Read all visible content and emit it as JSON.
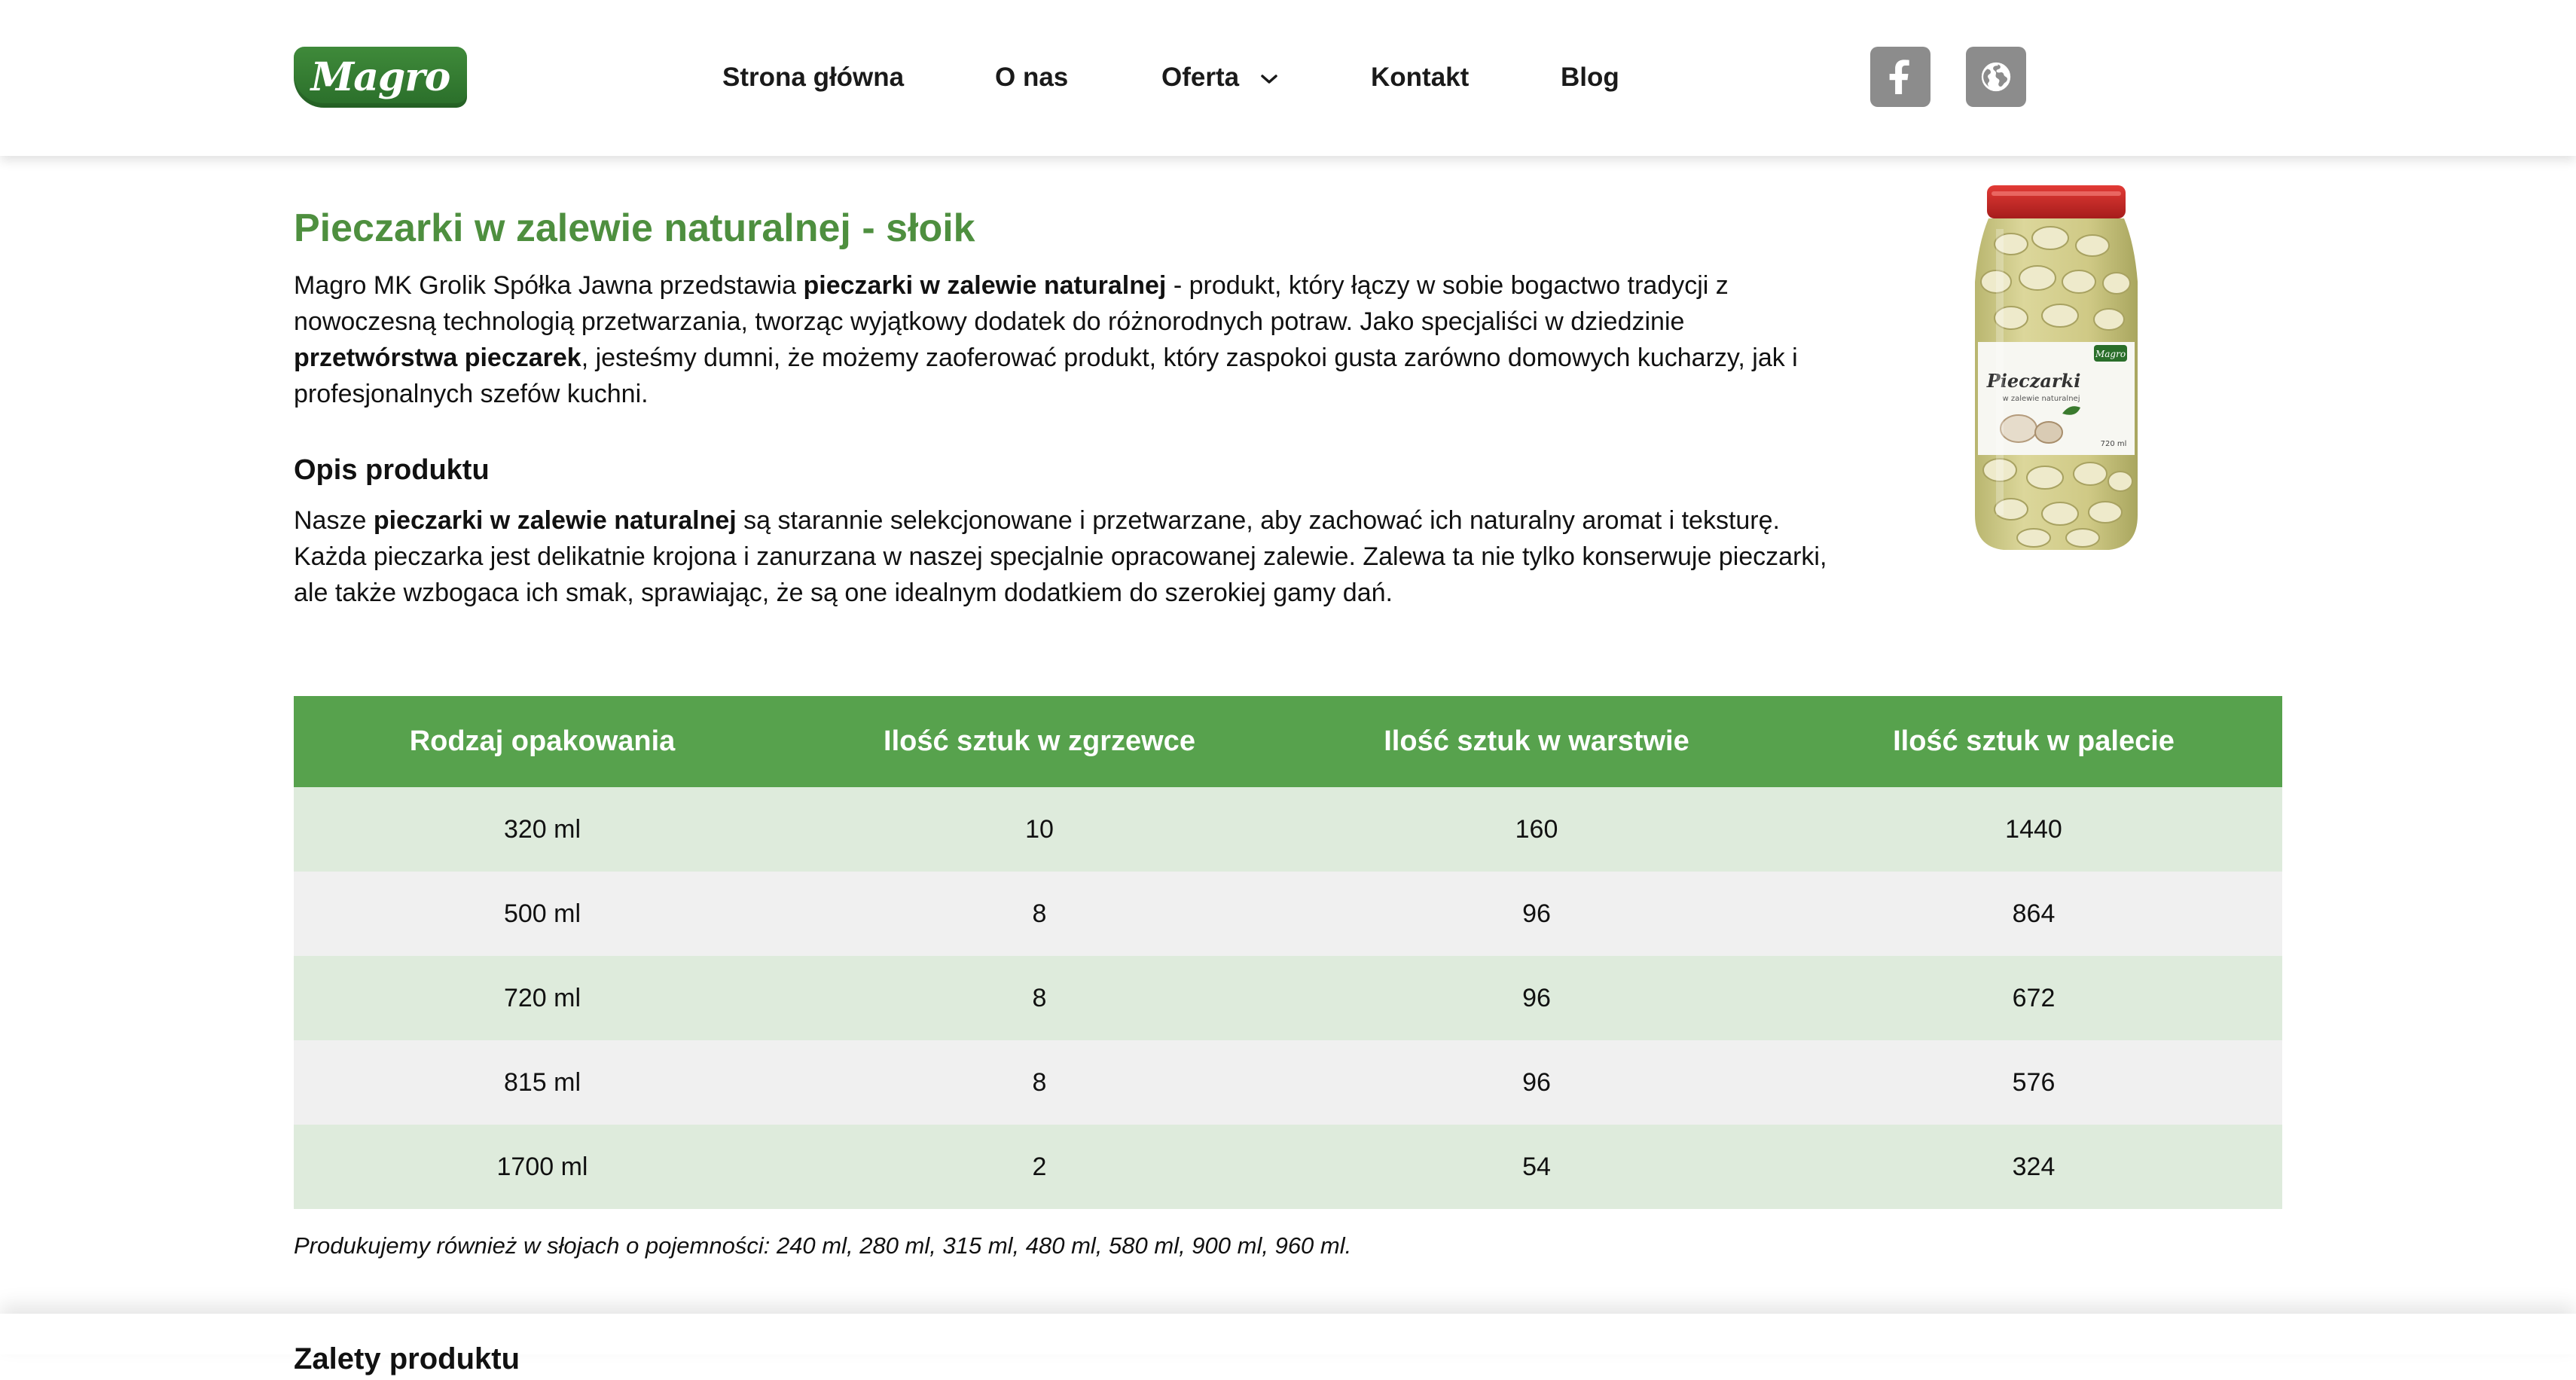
{
  "header": {
    "logo_text": "Magro",
    "nav": [
      "Strona główna",
      "O nas",
      "Oferta",
      "Kontakt",
      "Blog"
    ],
    "social": [
      "facebook-icon",
      "globe-icon"
    ]
  },
  "product": {
    "title": "Pieczarki w zalewie naturalnej - słoik",
    "intro": {
      "p1": "Magro MK Grolik Spółka Jawna przedstawia ",
      "b1": "pieczarki w zalewie naturalnej",
      "p2": " - produkt, który łączy w sobie bogactwo tradycji z nowoczesną technologią przetwarzania, tworząc wyjątkowy dodatek do różnorodnych potraw. Jako specjaliści w dziedzinie ",
      "b2": "przetwórstwa pieczarek",
      "p3": ", jesteśmy dumni, że możemy zaoferować produkt, który zaspokoi gusta zarówno domowych kucharzy, jak i profesjonalnych szefów kuchni."
    },
    "description_heading": "Opis produktu",
    "description": {
      "p1": "Nasze ",
      "b1": "pieczarki w zalewie naturalnej",
      "p2": " są starannie selekcjonowane i przetwarzane, aby zachować ich naturalny aromat i teksturę. Każda pieczarka jest delikatnie krojona i zanurzana w naszej specjalnie opracowanej zalewie. Zalewa ta nie tylko konserwuje pieczarki, ale także wzbogaca ich smak, sprawiając, że są one idealnym dodatkiem do szerokiej gamy dań."
    },
    "jar_label": {
      "brand": "Magro",
      "name": "Pieczarki",
      "sub": "w zalewie naturalnej",
      "volume": "720 ml"
    }
  },
  "table": {
    "headers": [
      "Rodzaj opakowania",
      "Ilość sztuk w zgrzewce",
      "Ilość sztuk w warstwie",
      "Ilość sztuk w palecie"
    ],
    "rows": [
      [
        "320 ml",
        "10",
        "160",
        "1440"
      ],
      [
        "500 ml",
        "8",
        "96",
        "864"
      ],
      [
        "720 ml",
        "8",
        "96",
        "672"
      ],
      [
        "815 ml",
        "8",
        "96",
        "576"
      ],
      [
        "1700 ml",
        "2",
        "54",
        "324"
      ]
    ]
  },
  "note": "Produkujemy również w słojach o pojemności: 240 ml, 280 ml, 315 ml, 480 ml, 580 ml, 900 ml, 960 ml.",
  "next_heading": "Zalety produktu",
  "colors": {
    "brand_green": "#4e8f3f",
    "table_header": "#57a24d",
    "row_tint": "#deebdc",
    "row_alt": "#f0f0f0",
    "social_bg": "#8c8c8c"
  }
}
